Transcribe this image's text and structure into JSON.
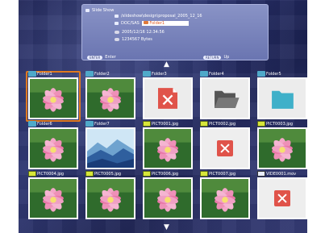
{
  "info_panel": {
    "title": "Slide Show",
    "path": "/slideshow\\design\\proposal_2005_12_16",
    "location_label": "DOC/SAS",
    "selected_name": "Folder1",
    "date": "2005/12/16 12:34:56",
    "size": "1234567 Bytes",
    "hint_enter_key": "ENTER",
    "hint_enter_text": "Enter",
    "hint_return_key": "RETURN",
    "hint_return_text": "Up"
  },
  "tiles": [
    {
      "label": "Folder1",
      "kind": "folder",
      "thumb": "flower"
    },
    {
      "label": "Folder2",
      "kind": "folder",
      "thumb": "flower"
    },
    {
      "label": "Folder3",
      "kind": "folder",
      "thumb": "error-file"
    },
    {
      "label": "Folder4",
      "kind": "folder",
      "thumb": "open-folder"
    },
    {
      "label": "Folder5",
      "kind": "folder",
      "thumb": "teal-folder"
    },
    {
      "label": "Folder6",
      "kind": "folder",
      "thumb": "flower"
    },
    {
      "label": "Folder7",
      "kind": "folder",
      "thumb": "mountains"
    },
    {
      "label": "PICT0001.jpg",
      "kind": "jpg",
      "thumb": "flower"
    },
    {
      "label": "PICT0002.jpg",
      "kind": "jpg",
      "thumb": "error"
    },
    {
      "label": "PICT0003.jpg",
      "kind": "jpg",
      "thumb": "flower"
    },
    {
      "label": "PICT0004.jpg",
      "kind": "jpg",
      "thumb": "flower"
    },
    {
      "label": "PICT0005.jpg",
      "kind": "jpg",
      "thumb": "flower"
    },
    {
      "label": "PICT0006.jpg",
      "kind": "jpg",
      "thumb": "flower"
    },
    {
      "label": "PICT0007.jpg",
      "kind": "jpg",
      "thumb": "flower"
    },
    {
      "label": "VIDE0001.mov",
      "kind": "mov",
      "thumb": "error"
    }
  ],
  "colors": {
    "selection": "#e07a20",
    "error": "#e0534a",
    "folder_badge": "#4fa9c9"
  }
}
